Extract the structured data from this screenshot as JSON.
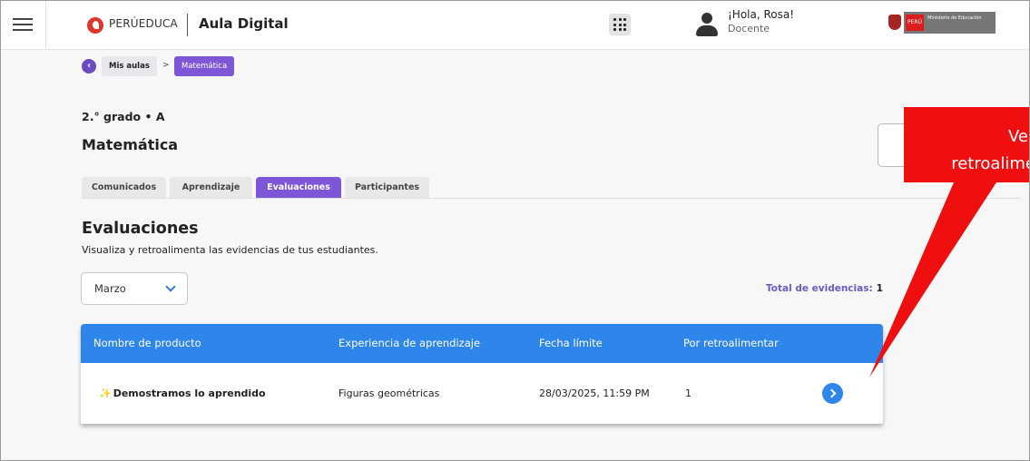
{
  "header": {
    "brand": "PERÚEDUCA",
    "app_title": "Aula Digital",
    "greeting": "¡Hola, Rosa!",
    "role": "Docente",
    "ministry_country": "PERÚ",
    "ministry_name": "Ministerio de Educación"
  },
  "breadcrumb": {
    "item1": "Mis aulas",
    "separator": ">",
    "item2": "Matemática"
  },
  "course": {
    "grade": "2.° grado • A",
    "subject": "Matemática"
  },
  "tabs": [
    {
      "label": "Comunicados",
      "active": false
    },
    {
      "label": "Aprendizaje",
      "active": false
    },
    {
      "label": "Evaluaciones",
      "active": true
    },
    {
      "label": "Participantes",
      "active": false
    }
  ],
  "section": {
    "title": "Evaluaciones",
    "description": "Visualiza y retroalimenta las evidencias de tus estudiantes."
  },
  "filter": {
    "month": "Marzo"
  },
  "total": {
    "label": "Total de evidencias:",
    "count": "1"
  },
  "table": {
    "headers": [
      "Nombre de producto",
      "Experiencia de aprendizaje",
      "Fecha límite",
      "Por retroalimentar"
    ],
    "rows": [
      {
        "name": "Demostramos lo aprendido",
        "experience": "Figuras geométricas",
        "deadline": "28/03/2025, 11:59 PM",
        "pending": "1"
      }
    ]
  },
  "callout": {
    "line1": "Ve",
    "line2": "retroalime"
  },
  "colors": {
    "accent_purple": "#7e56d8",
    "table_blue": "#2f86ea",
    "callout_red": "#ef0f0f"
  }
}
